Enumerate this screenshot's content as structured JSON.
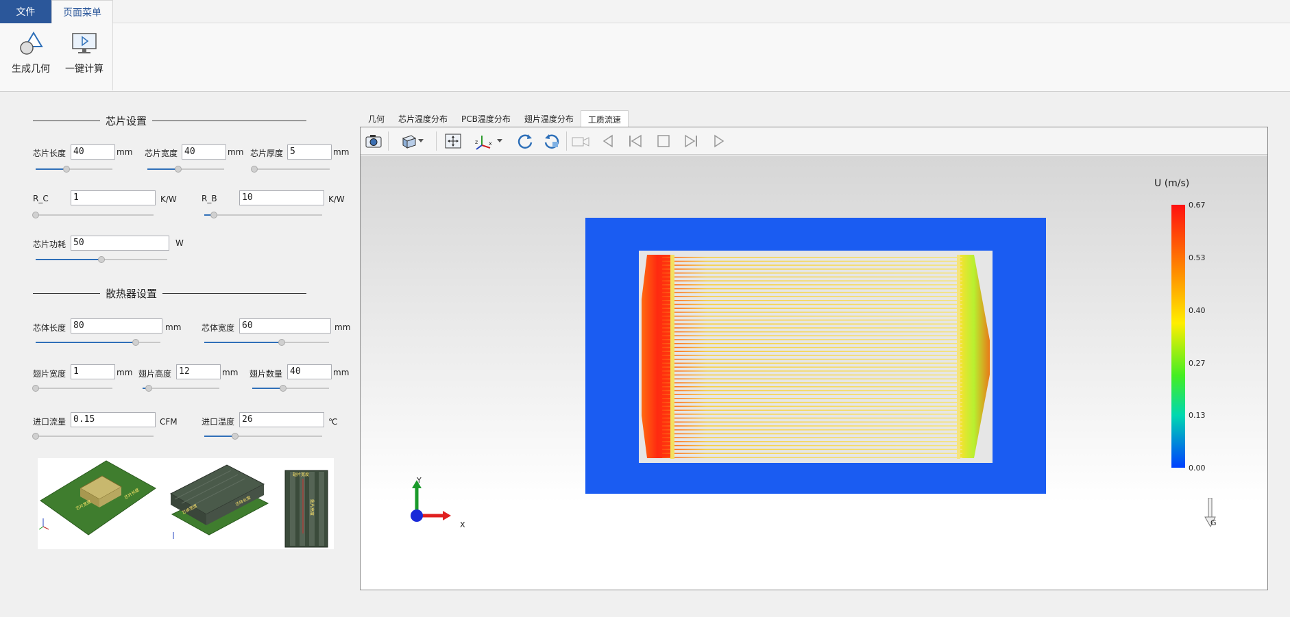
{
  "menu": {
    "file": "文件",
    "page_menu": "页面菜单"
  },
  "ribbon": {
    "generate_geometry": "生成几何",
    "one_click_calc": "一键计算"
  },
  "chip_section": {
    "title": "芯片设置",
    "length_label": "芯片长度",
    "length_value": "40",
    "length_unit": "mm",
    "length_slider": 0.4,
    "width_label": "芯片宽度",
    "width_value": "40",
    "width_unit": "mm",
    "width_slider": 0.4,
    "thickness_label": "芯片厚度",
    "thickness_value": "5",
    "thickness_unit": "mm",
    "thickness_slider": 0.0,
    "rc_label": "R_C",
    "rc_value": "1",
    "rc_unit": "K/W",
    "rc_slider": 0.0,
    "rb_label": "R_B",
    "rb_value": "10",
    "rb_unit": "K/W",
    "rb_slider": 0.08,
    "power_label": "芯片功耗",
    "power_value": "50",
    "power_unit": "W",
    "power_slider": 0.5
  },
  "sink_section": {
    "title": "散热器设置",
    "core_length_label": "芯体长度",
    "core_length_value": "80",
    "core_length_unit": "mm",
    "core_length_slider": 0.8,
    "core_width_label": "芯体宽度",
    "core_width_value": "60",
    "core_width_unit": "mm",
    "core_width_slider": 0.62,
    "fin_width_label": "翅片宽度",
    "fin_width_value": "1",
    "fin_width_unit": "mm",
    "fin_width_slider": 0.0,
    "fin_height_label": "翅片高度",
    "fin_height_value": "12",
    "fin_height_unit": "mm",
    "fin_height_slider": 0.08,
    "fin_count_label": "翅片数量",
    "fin_count_value": "40",
    "fin_count_unit": "mm",
    "fin_count_slider": 0.4,
    "inlet_flow_label": "进口流量",
    "inlet_flow_value": "0.15",
    "inlet_flow_unit": "CFM",
    "inlet_flow_slider": 0.0,
    "inlet_temp_label": "进口温度",
    "inlet_temp_value": "26",
    "inlet_temp_unit": "℃",
    "inlet_temp_slider": 0.26
  },
  "preview": {
    "chip_length": "芯片长度",
    "chip_width": "芯片宽度",
    "core_length": "芯体长度",
    "core_width": "芯体宽度",
    "fin_width": "翅片宽度",
    "fin_height": "翅片高度"
  },
  "viewer_tabs": [
    "几何",
    "芯片温度分布",
    "PCB温度分布",
    "翅片温度分布",
    "工质流速"
  ],
  "viewer_active_tab": 4,
  "legend": {
    "title": "U (m/s)",
    "ticks": [
      "0.67",
      "0.53",
      "0.40",
      "0.27",
      "0.13",
      "0.00"
    ]
  },
  "axes": {
    "x": "X",
    "y": "Y",
    "gravity": "G"
  },
  "colors": {
    "accent": "#2b579a",
    "field_blue": "#1a5cf2",
    "fin_yellow": "#f5e47a",
    "hot_red": "#ff2a10"
  }
}
